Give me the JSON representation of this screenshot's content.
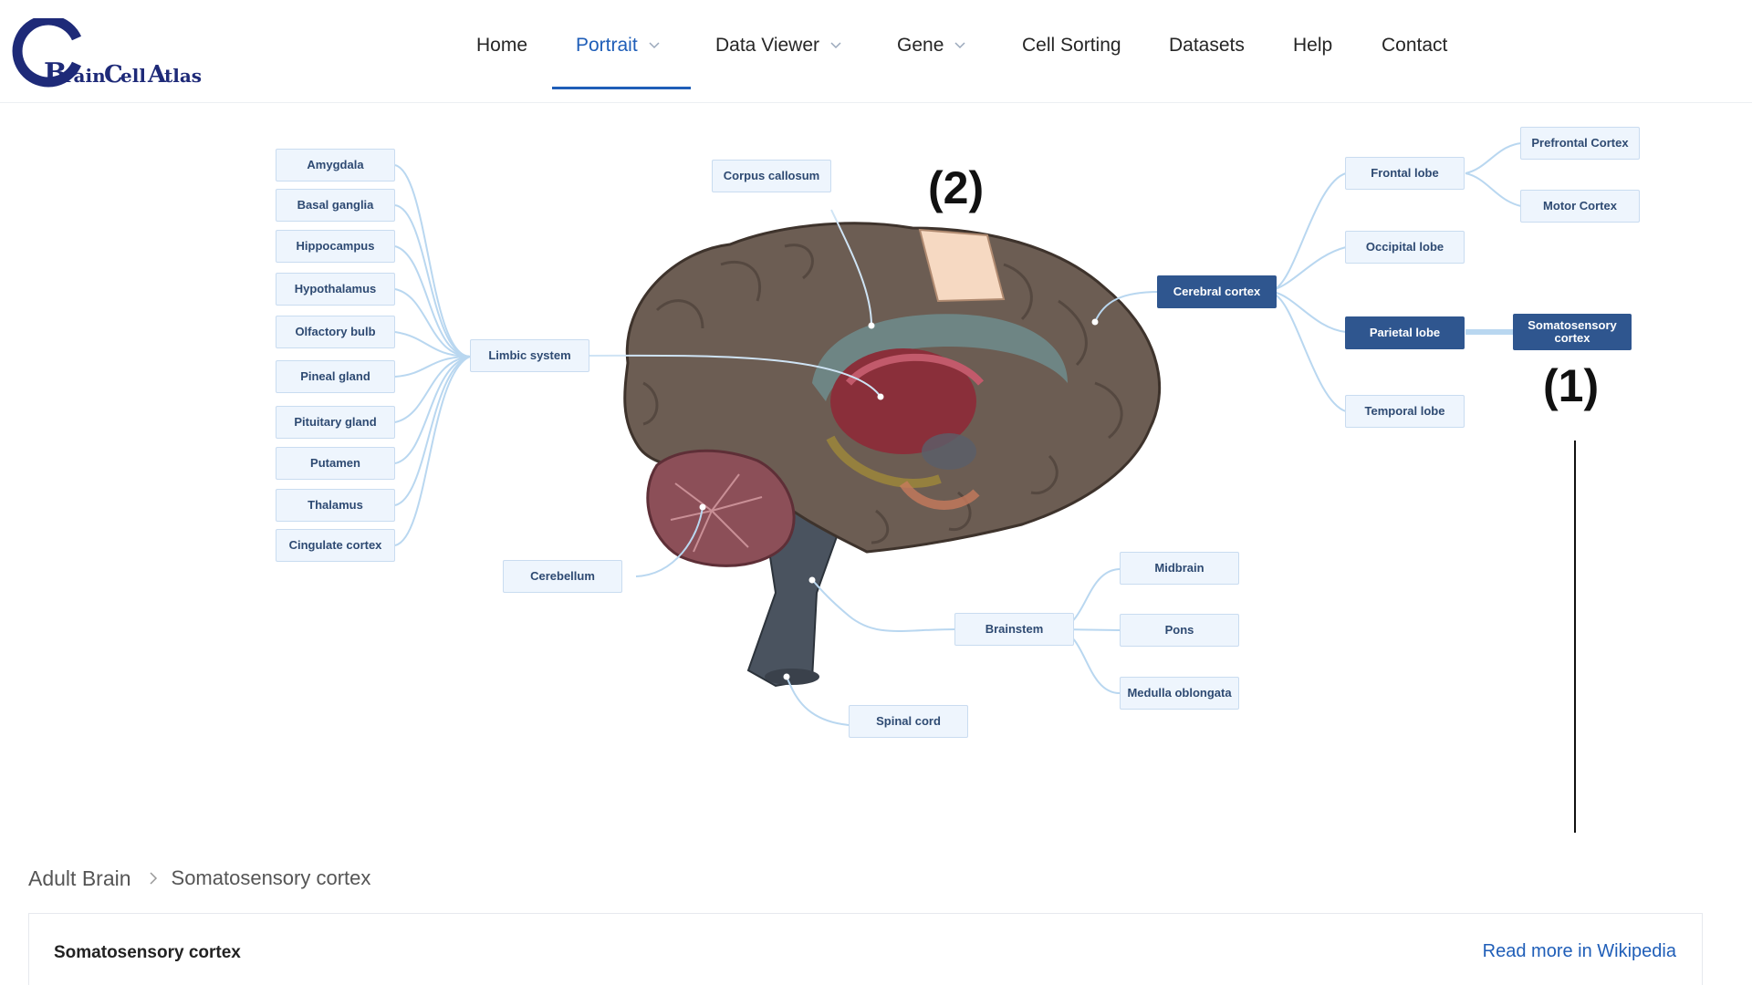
{
  "brand": {
    "logo_text": "BrainCellAtlas",
    "logo_color": "#1e2a78"
  },
  "nav": {
    "items": [
      {
        "label": "Home",
        "has_dropdown": false
      },
      {
        "label": "Portrait",
        "has_dropdown": true,
        "active": true
      },
      {
        "label": "Data Viewer",
        "has_dropdown": true
      },
      {
        "label": "Gene",
        "has_dropdown": true
      },
      {
        "label": "Cell Sorting",
        "has_dropdown": false
      },
      {
        "label": "Datasets",
        "has_dropdown": false
      },
      {
        "label": "Help",
        "has_dropdown": false
      },
      {
        "label": "Contact",
        "has_dropdown": false
      }
    ],
    "active_color": "#1f5eb8"
  },
  "diagram": {
    "limbic_children": [
      "Amygdala",
      "Basal ganglia",
      "Hippocampus",
      "Hypothalamus",
      "Olfactory bulb",
      "Pineal gland",
      "Pituitary gland",
      "Putamen",
      "Thalamus",
      "Cingulate cortex"
    ],
    "limbic_system": "Limbic system",
    "corpus_callosum": "Corpus callosum",
    "cerebellum": "Cerebellum",
    "cerebral_cortex": "Cerebral cortex",
    "lobes": [
      "Frontal lobe",
      "Occipital lobe",
      "Parietal lobe",
      "Temporal lobe"
    ],
    "frontal_children": [
      "Prefrontal Cortex",
      "Motor Cortex"
    ],
    "parietal_child": "Somatosensory cortex",
    "brainstem": "Brainstem",
    "brainstem_children": [
      "Midbrain",
      "Pons",
      "Medulla oblongata"
    ],
    "spinal_cord": "Spinal cord",
    "selected": [
      "Cerebral cortex",
      "Parietal lobe",
      "Somatosensory cortex"
    ],
    "node_color": "#eef5fd",
    "selected_color": "#2f568f",
    "annotation_1": "(1)",
    "annotation_2": "(2)"
  },
  "breadcrumb": {
    "root": "Adult Brain",
    "current": "Somatosensory cortex"
  },
  "panel": {
    "title": "Somatosensory cortex",
    "link": "Read more in Wikipedia"
  }
}
